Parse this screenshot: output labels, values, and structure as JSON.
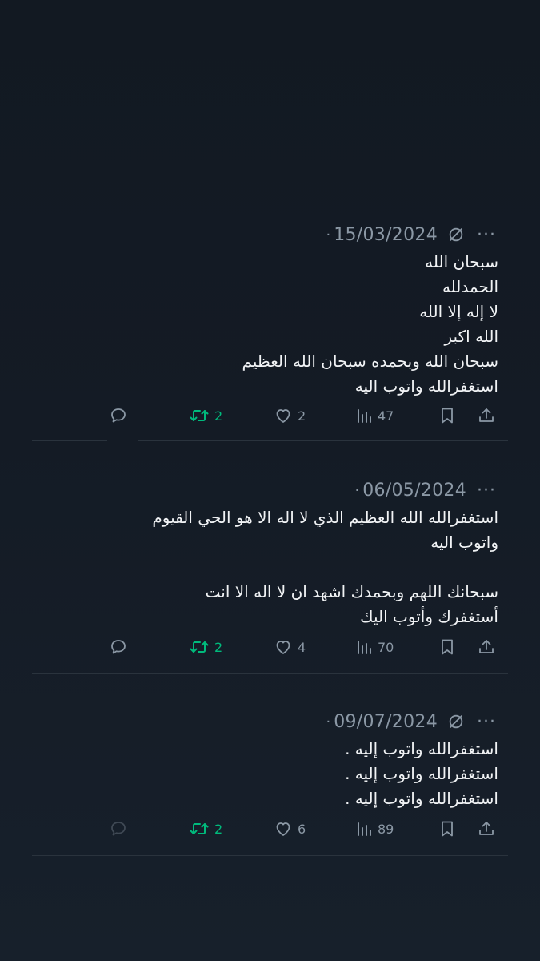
{
  "tweets": [
    {
      "date": "15/03/2024",
      "body_lines": [
        "سبحان الله",
        "الحمدلله",
        "لا إله إلا الله",
        "الله اكبر",
        "سبحان الله وبحمده سبحان الله العظيم",
        "استغفرالله واتوب اليه"
      ],
      "retweets": "2",
      "likes": "2",
      "views": "47"
    },
    {
      "date": "06/05/2024",
      "body_lines": [
        "استغفرالله الله العظيم الذي لا اله الا هو الحي القيوم",
        "واتوب اليه",
        "",
        "سبحانك اللهم وبحمدك اشهد ان لا اله الا انت",
        "أستغفرك وأتوب اليك"
      ],
      "retweets": "2",
      "likes": "4",
      "views": "70"
    },
    {
      "date": "09/07/2024",
      "body_lines": [
        "استغفرالله واتوب إليه .",
        "استغفرالله واتوب إليه .",
        "استغفرالله واتوب إليه ."
      ],
      "retweets": "2",
      "likes": "6",
      "views": "89"
    }
  ],
  "colors": {
    "background": "#141b25",
    "text": "#f1f3f5",
    "muted": "#8b98a5",
    "retweet_green": "#00ba7c",
    "divider": "#2a333d"
  },
  "icons": {
    "reply": "speech-bubble-icon",
    "retweet": "retweet-arrows-icon",
    "like": "heart-icon",
    "views": "bar-chart-icon",
    "bookmark": "bookmark-icon",
    "share": "share-upload-icon",
    "translate": "globe-slash-icon",
    "more": "more-dots-icon"
  }
}
